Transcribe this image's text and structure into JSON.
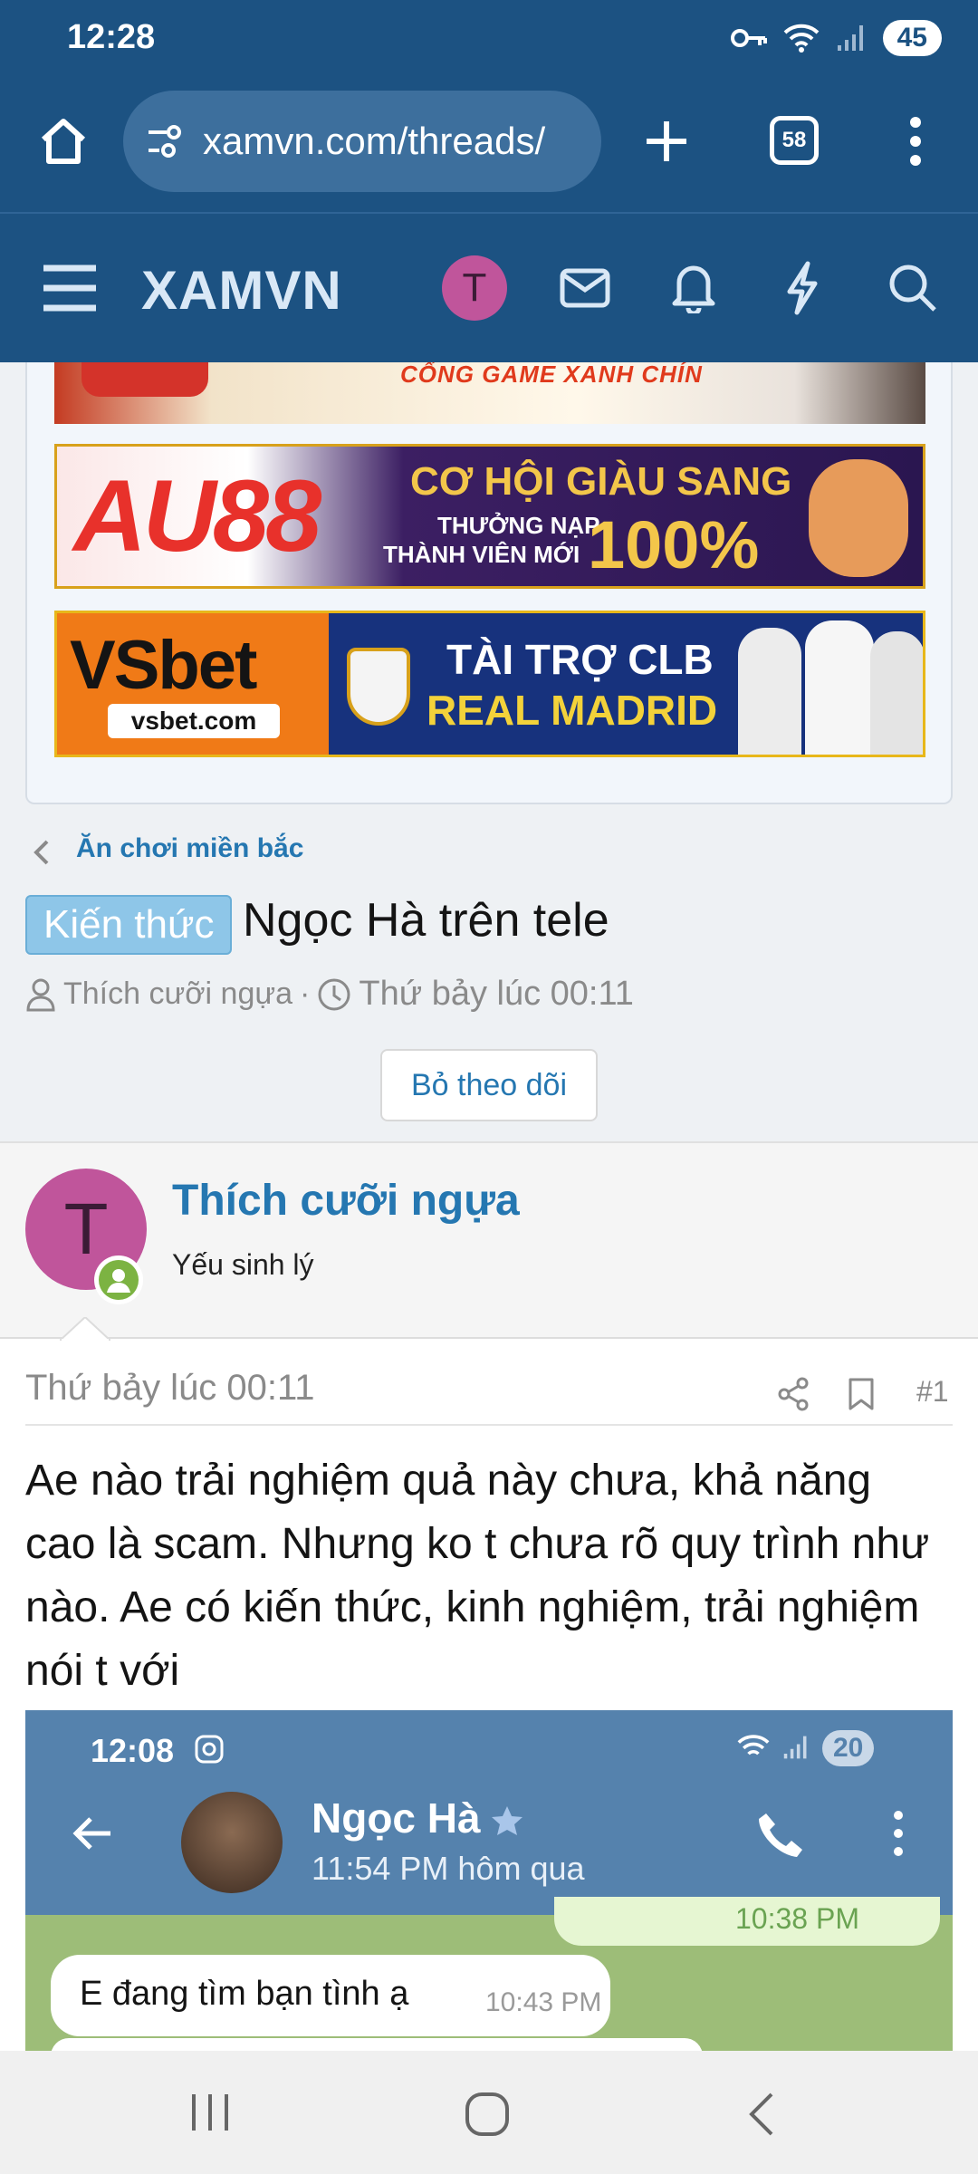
{
  "status_bar": {
    "time": "12:28",
    "battery": "45"
  },
  "browser": {
    "url": "xamvn.com/threads/",
    "tab_count": "58"
  },
  "site": {
    "logo": "XAMVN",
    "user_initial": "T"
  },
  "ads": {
    "banner1_text": "CỔNG GAME XANH CHÍN",
    "banner2_brand": "AU88",
    "banner2_headline": "CƠ HỘI GIÀU SANG",
    "banner2_line1": "THƯỞNG NẠP",
    "banner2_line2": "THÀNH VIÊN MỚI",
    "banner2_percent": "100%",
    "banner3_brand": "VSbet",
    "banner3_domain": "vsbet.com",
    "banner3_line1": "TÀI TRỢ CLB",
    "banner3_line2": "REAL MADRID"
  },
  "thread": {
    "breadcrumb": "Ăn chơi miền bắc",
    "prefix": "Kiến thức",
    "title": "Ngọc Hà trên tele",
    "author": "Thích cưỡi ngựa",
    "separator": "·",
    "date": "Thứ bảy lúc 00:11",
    "follow_label": "Bỏ theo dõi"
  },
  "post": {
    "user_initial": "T",
    "username": "Thích cưỡi ngựa",
    "user_title": "Yếu sinh lý",
    "date": "Thứ bảy lúc 00:11",
    "number": "#1",
    "body": "Ae nào trải nghiệm quả này chưa, khả năng cao là scam. Nhưng ko t chưa rõ quy trình như nào. Ae có kiến thức, kinh nghiệm, trải nghiệm nói t với"
  },
  "embedded": {
    "time": "12:08",
    "battery": "20",
    "contact_name": "Ngọc Hà",
    "last_seen": "11:54 PM hôm qua",
    "prev_time": "10:38 PM",
    "message": "E đang tìm bạn tình ạ",
    "message_time": "10:43 PM"
  }
}
